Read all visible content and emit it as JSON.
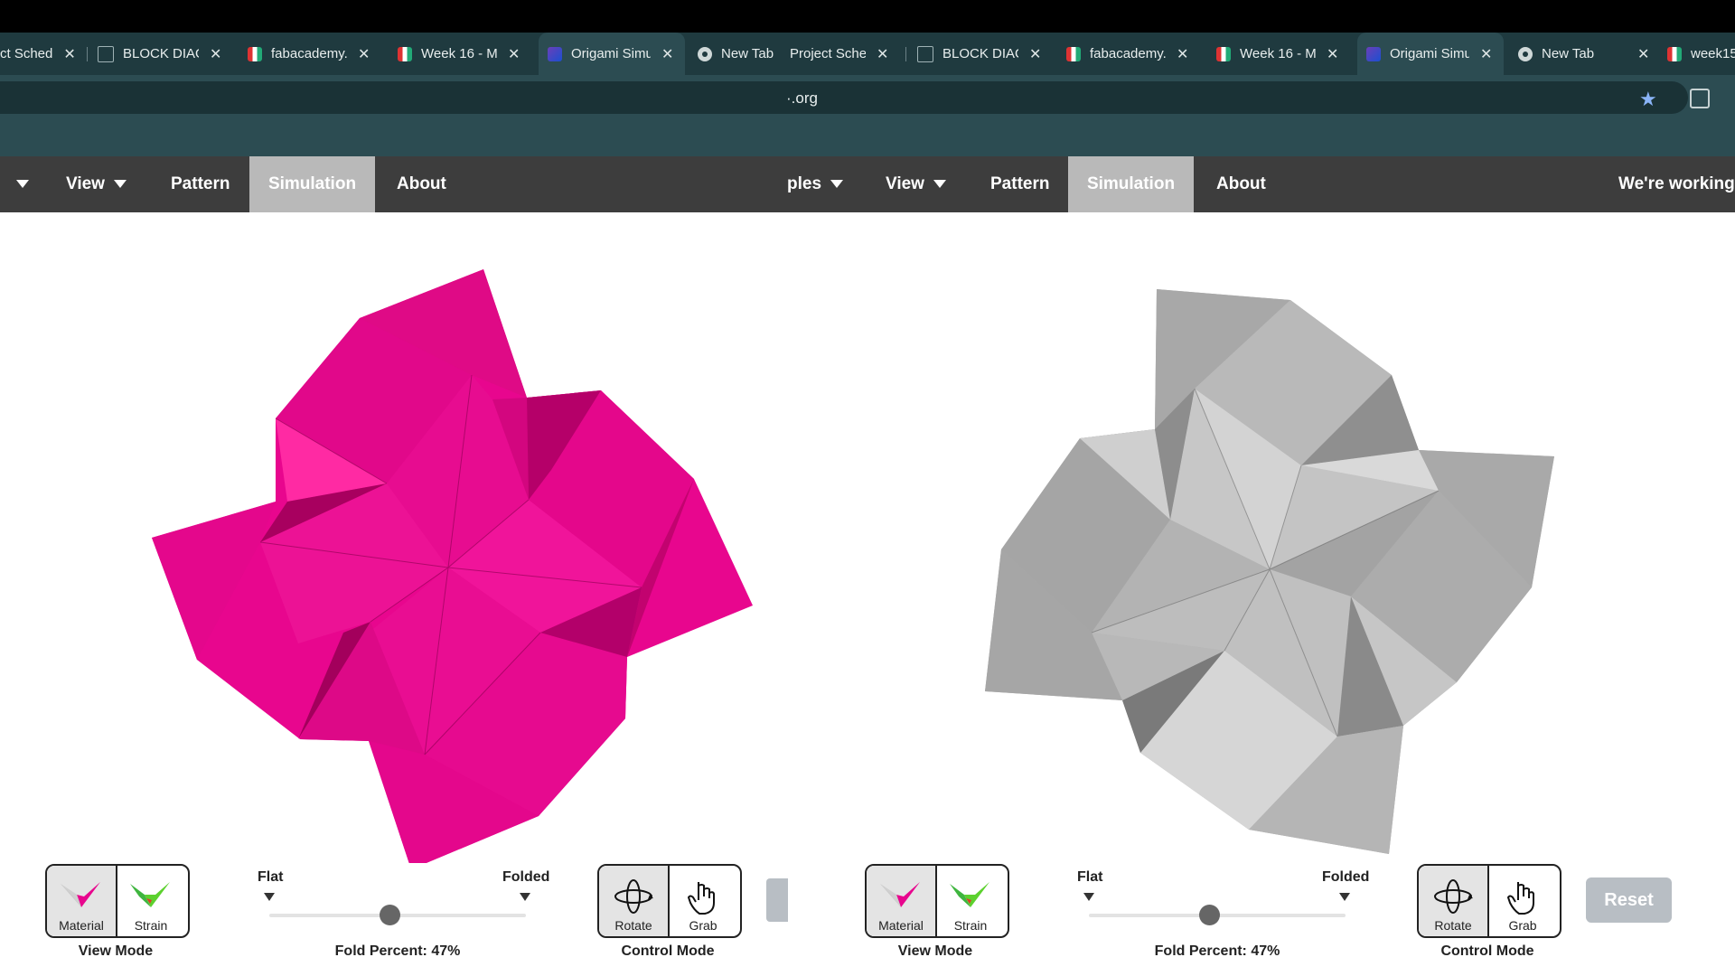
{
  "tabs": [
    {
      "title": "ct Sched",
      "icon": "none",
      "active": false
    },
    {
      "title": "BLOCK DIAGI",
      "icon": "diagram-icon",
      "active": false
    },
    {
      "title": "fabacademy.c",
      "icon": "fabacademy-icon",
      "active": false
    },
    {
      "title": "Week 16 - Mi",
      "icon": "fabacademy-icon",
      "active": false
    },
    {
      "title": "Origami Simu",
      "icon": "origami-icon",
      "active": true
    },
    {
      "title": "New Tab",
      "icon": "chrome-icon",
      "active": false
    },
    {
      "title": "Project Schec",
      "icon": "none",
      "active": false
    },
    {
      "title": "BLOCK DIAGI",
      "icon": "diagram-icon",
      "active": false
    },
    {
      "title": "fabacademy.c",
      "icon": "fabacademy-icon",
      "active": false
    },
    {
      "title": "Week 16 - Mi",
      "icon": "fabacademy-icon",
      "active": false
    },
    {
      "title": "Origami Simu",
      "icon": "origami-icon",
      "active": true
    },
    {
      "title": "New Tab",
      "icon": "chrome-icon",
      "active": false
    },
    {
      "title": "week15",
      "icon": "fabacademy-icon",
      "active": false
    }
  ],
  "address": {
    "url": "·.org",
    "star_icon": "bookmark-star-icon",
    "ext_icon": "extensions-icon"
  },
  "menu_left": {
    "view": "View",
    "pattern": "Pattern",
    "simulation": "Simulation",
    "about": "About"
  },
  "menu_right": {
    "examples": "ples",
    "view": "View",
    "pattern": "Pattern",
    "simulation": "Simulation",
    "about": "About",
    "working": "We're working"
  },
  "panels": [
    {
      "model_color": "#e8068e",
      "view_mode": {
        "material": "Material",
        "strain": "Strain",
        "caption": "View Mode"
      },
      "slider": {
        "flat": "Flat",
        "folded": "Folded",
        "fold_percent_label": "Fold Percent: 47%",
        "fold_percent": 0.47
      },
      "control_mode": {
        "rotate": "Rotate",
        "grab": "Grab",
        "caption": "Control Mode"
      }
    },
    {
      "model_color": "#b4b4b4",
      "view_mode": {
        "material": "Material",
        "strain": "Strain",
        "caption": "View Mode"
      },
      "slider": {
        "flat": "Flat",
        "folded": "Folded",
        "fold_percent_label": "Fold Percent: 47%",
        "fold_percent": 0.47
      },
      "control_mode": {
        "rotate": "Rotate",
        "grab": "Grab",
        "caption": "Control Mode"
      },
      "reset": "Reset"
    }
  ]
}
